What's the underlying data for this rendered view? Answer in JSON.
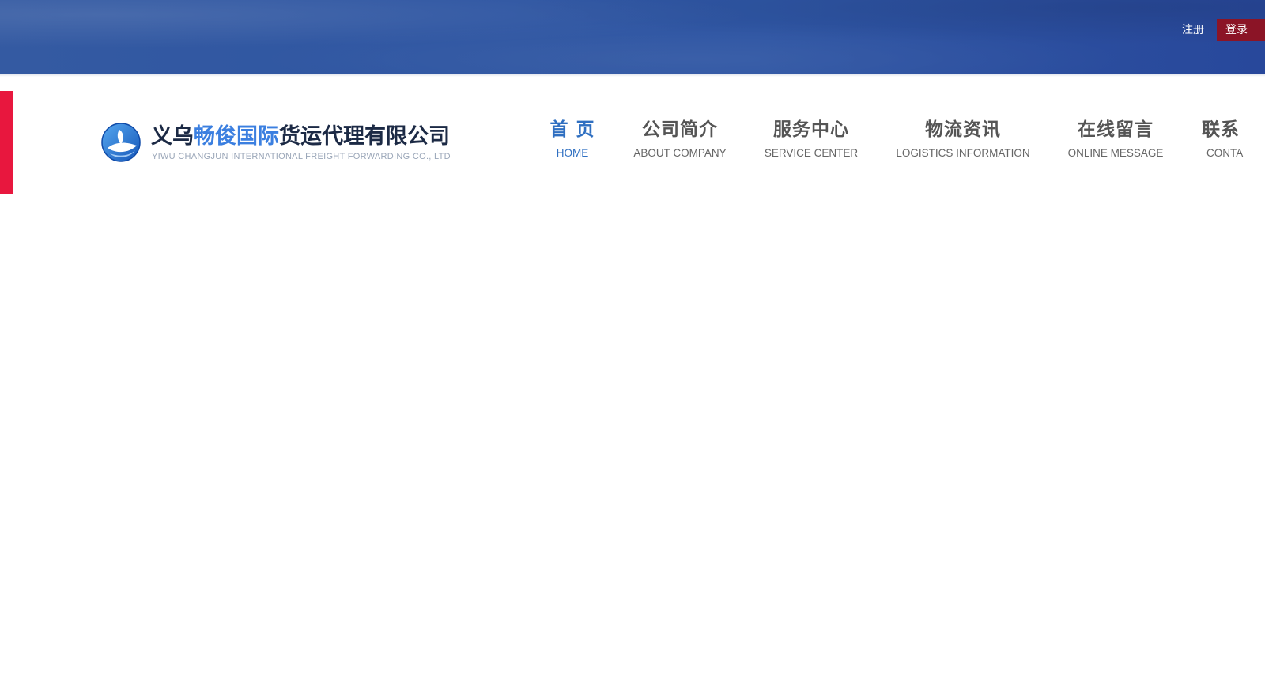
{
  "header": {
    "register_label": "注册",
    "login_label": "登录",
    "bar_color": "#2f56a2",
    "login_bg": "#8b1426"
  },
  "side_tab": {
    "color": "#e8173e"
  },
  "logo": {
    "cn_name_prefix": "义乌",
    "cn_name_highlight": "畅俊国际",
    "cn_name_suffix": "货运代理有限公司",
    "en_name": "YIWU CHANGJUN INTERNATIONAL FREIGHT FORWARDING CO., LTD",
    "emblem_icon": "globe-swoosh-icon",
    "highlight_color": "#3b7fe0"
  },
  "nav": {
    "active_color": "#2f6fc1",
    "items": [
      {
        "cn": "首 页",
        "en": "HOME",
        "active": true
      },
      {
        "cn": "公司简介",
        "en": "ABOUT COMPANY",
        "active": false
      },
      {
        "cn": "服务中心",
        "en": "SERVICE CENTER",
        "active": false
      },
      {
        "cn": "物流资讯",
        "en": "LOGISTICS INFORMATION",
        "active": false
      },
      {
        "cn": "在线留言",
        "en": "ONLINE MESSAGE",
        "active": false
      },
      {
        "cn": "联系",
        "en": "CONTA",
        "active": false
      }
    ]
  }
}
